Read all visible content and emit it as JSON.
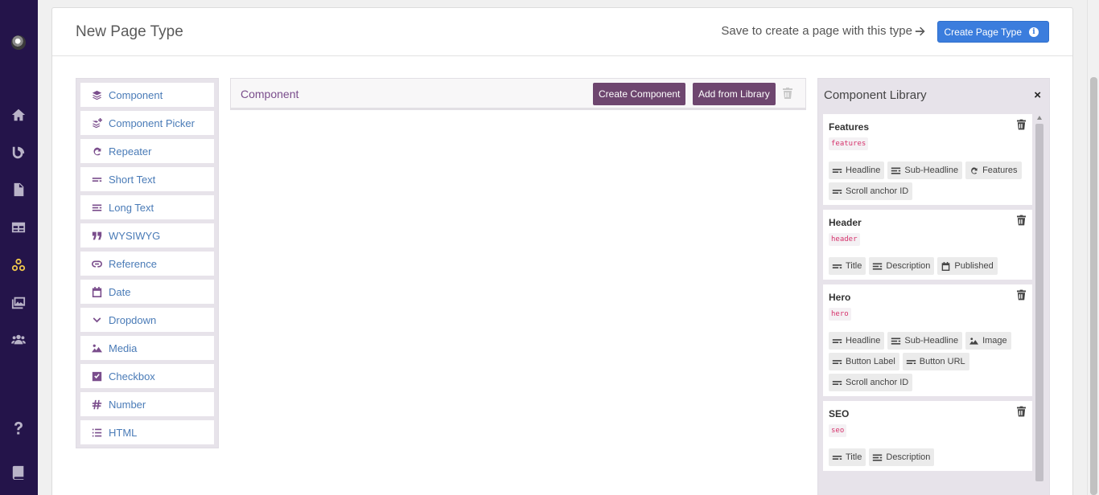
{
  "nav": {
    "items": [
      {
        "icon": "home-icon"
      },
      {
        "icon": "blog-icon"
      },
      {
        "icon": "document-icon"
      },
      {
        "icon": "table-icon"
      },
      {
        "icon": "components-icon",
        "active": true
      },
      {
        "icon": "media-icon"
      },
      {
        "icon": "users-icon"
      },
      {
        "icon": "help-icon"
      },
      {
        "icon": "book-icon"
      }
    ]
  },
  "header": {
    "title": "New Page Type",
    "save_hint": "Save to create a page with this type",
    "create_button": "Create Page Type"
  },
  "palette": {
    "items": [
      {
        "label": "Component",
        "icon": "layers-icon"
      },
      {
        "label": "Component Picker",
        "icon": "layers-plus-icon"
      },
      {
        "label": "Repeater",
        "icon": "repeat-icon"
      },
      {
        "label": "Short Text",
        "icon": "short-text-icon"
      },
      {
        "label": "Long Text",
        "icon": "long-text-icon"
      },
      {
        "label": "WYSIWYG",
        "icon": "quote-icon"
      },
      {
        "label": "Reference",
        "icon": "link-icon"
      },
      {
        "label": "Date",
        "icon": "calendar-icon"
      },
      {
        "label": "Dropdown",
        "icon": "chevron-down-icon"
      },
      {
        "label": "Media",
        "icon": "image-icon"
      },
      {
        "label": "Checkbox",
        "icon": "checkbox-icon"
      },
      {
        "label": "Number",
        "icon": "hash-icon"
      },
      {
        "label": "HTML",
        "icon": "list-icon"
      }
    ]
  },
  "editor": {
    "title": "Component",
    "create_button": "Create Component",
    "library_button": "Add from Library"
  },
  "library": {
    "title": "Component Library",
    "close": "×",
    "components": [
      {
        "name": "Features",
        "slug": "features",
        "fields": [
          {
            "label": "Headline",
            "icon": "short-text-icon"
          },
          {
            "label": "Sub-Headline",
            "icon": "long-text-icon"
          },
          {
            "label": "Features",
            "icon": "repeat-icon"
          },
          {
            "label": "Scroll anchor ID",
            "icon": "short-text-icon"
          }
        ]
      },
      {
        "name": "Header",
        "slug": "header",
        "fields": [
          {
            "label": "Title",
            "icon": "short-text-icon"
          },
          {
            "label": "Description",
            "icon": "long-text-icon"
          },
          {
            "label": "Published",
            "icon": "calendar-icon"
          }
        ]
      },
      {
        "name": "Hero",
        "slug": "hero",
        "fields": [
          {
            "label": "Headline",
            "icon": "short-text-icon"
          },
          {
            "label": "Sub-Headline",
            "icon": "long-text-icon"
          },
          {
            "label": "Image",
            "icon": "image-icon"
          },
          {
            "label": "Button Label",
            "icon": "short-text-icon"
          },
          {
            "label": "Button URL",
            "icon": "short-text-icon"
          },
          {
            "label": "Scroll anchor ID",
            "icon": "short-text-icon"
          }
        ]
      },
      {
        "name": "SEO",
        "slug": "seo",
        "fields": [
          {
            "label": "Title",
            "icon": "short-text-icon"
          },
          {
            "label": "Description",
            "icon": "long-text-icon"
          }
        ]
      }
    ]
  }
}
